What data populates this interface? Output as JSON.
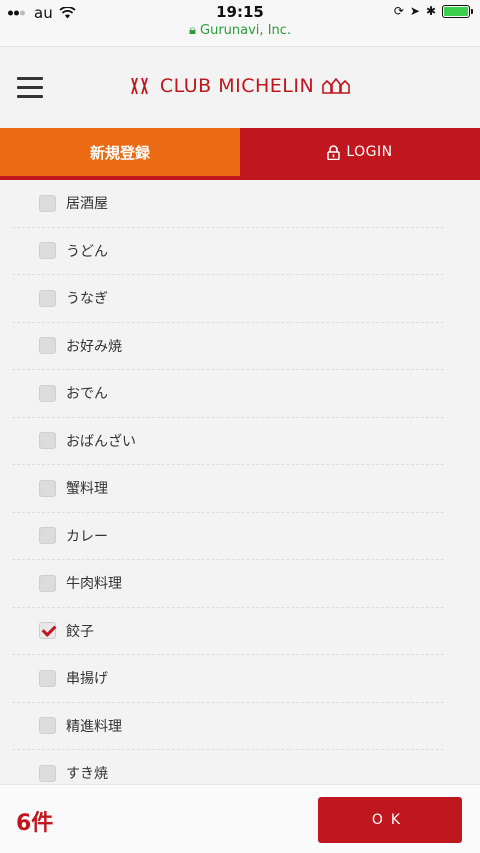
{
  "status_bar": {
    "carrier": "au",
    "time": "19:15",
    "url": "Gurunavi, Inc."
  },
  "header": {
    "logo_text": "CLUB MICHELIN"
  },
  "tabs": {
    "register_label": "新規登録",
    "login_label": "LOGIN"
  },
  "items": [
    {
      "label": "居酒屋",
      "checked": false
    },
    {
      "label": "うどん",
      "checked": false
    },
    {
      "label": "うなぎ",
      "checked": false
    },
    {
      "label": "お好み焼",
      "checked": false
    },
    {
      "label": "おでん",
      "checked": false
    },
    {
      "label": "おばんざい",
      "checked": false
    },
    {
      "label": "蟹料理",
      "checked": false
    },
    {
      "label": "カレー",
      "checked": false
    },
    {
      "label": "牛肉料理",
      "checked": false
    },
    {
      "label": "餃子",
      "checked": true
    },
    {
      "label": "串揚げ",
      "checked": false
    },
    {
      "label": "精進料理",
      "checked": false
    },
    {
      "label": "すき焼",
      "checked": false
    }
  ],
  "footer": {
    "count": "6件",
    "ok_label": "OK"
  },
  "colors": {
    "brand_red": "#c0161e",
    "accent_orange": "#ec6a13",
    "secure_green": "#2c9e3a"
  }
}
